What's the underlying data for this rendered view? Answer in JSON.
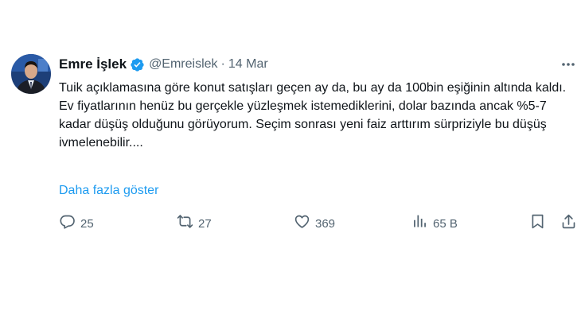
{
  "author": {
    "name": "Emre İşlek",
    "handle": "@Emreislek",
    "separator": "·",
    "date": "14 Mar"
  },
  "tweet": {
    "paragraph_1": "Tuik açıklamasına göre konut satışları geçen ay da, bu ay da 100bin eşiğinin altında kaldı.",
    "paragraph_2": "Ev fiyatlarının henüz bu gerçekle yüzleşmek istemediklerini, dolar bazında ancak %5-7 kadar düşüş olduğunu görüyorum. Seçim sonrası yeni faiz arttırım sürpriziyle bu düşüş ivmelenebilir....",
    "show_more": "Daha fazla göster"
  },
  "actions": {
    "replies": "25",
    "retweets": "27",
    "likes": "369",
    "views": "65 B"
  },
  "icons": {
    "verified": "verified-badge-icon",
    "more": "more-dots-icon",
    "reply": "reply-icon",
    "retweet": "retweet-icon",
    "like": "heart-icon",
    "views": "views-chart-icon",
    "bookmark": "bookmark-icon",
    "share": "share-icon"
  },
  "colors": {
    "accent": "#1d9bf0",
    "text": "#0f1419",
    "muted": "#536471"
  }
}
